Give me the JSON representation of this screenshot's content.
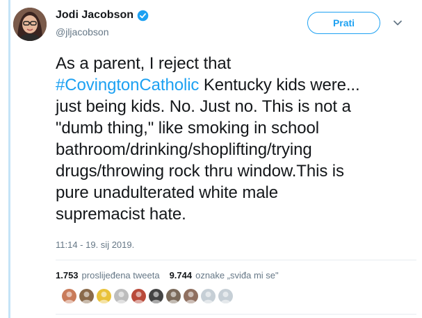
{
  "author": {
    "name": "Jodi Jacobson",
    "handle": "@jljacobson",
    "verified": true,
    "avatar_icon": "profile-photo-avatar"
  },
  "follow": {
    "label": "Prati"
  },
  "menu": {
    "icon": "chevron-down-icon"
  },
  "tweet": {
    "lines": [
      {
        "text": "As a parent, I reject that"
      },
      {
        "hashtag": "#CovingtonCatholic",
        "text": " Kentucky kids were..."
      },
      {
        "text": "just being kids. No. Just no. This is not a"
      },
      {
        "text": "\"dumb thing,\" like smoking in school"
      },
      {
        "text": "bathroom/drinking/shoplifting/trying"
      },
      {
        "text": "drugs/throwing rock thru window.This is"
      },
      {
        "text": "pure unadulterated white male"
      },
      {
        "text": "supremacist hate."
      }
    ]
  },
  "timestamp": "11:14 - 19. sij 2019.",
  "stats": {
    "retweets_count": "1.753",
    "retweets_label": "proslijeđena tweeta",
    "likes_count": "9.744",
    "likes_label": "oznake „sviđa mi se\""
  },
  "likers": [
    {
      "color": "#c97b5a"
    },
    {
      "color": "#8a6a4a"
    },
    {
      "color": "#e9c23a"
    },
    {
      "color": "#bdbdbd"
    },
    {
      "color": "#b94a3a"
    },
    {
      "color": "#444444"
    },
    {
      "color": "#7a6a5a"
    },
    {
      "color": "#8f6f5f"
    },
    {
      "color": "#c6cfd6"
    },
    {
      "color": "#c6cfd6"
    }
  ],
  "colors": {
    "accent": "#1da1f2",
    "text": "#14171a",
    "muted": "#657786",
    "thread_rail": "#c4e4f7"
  }
}
